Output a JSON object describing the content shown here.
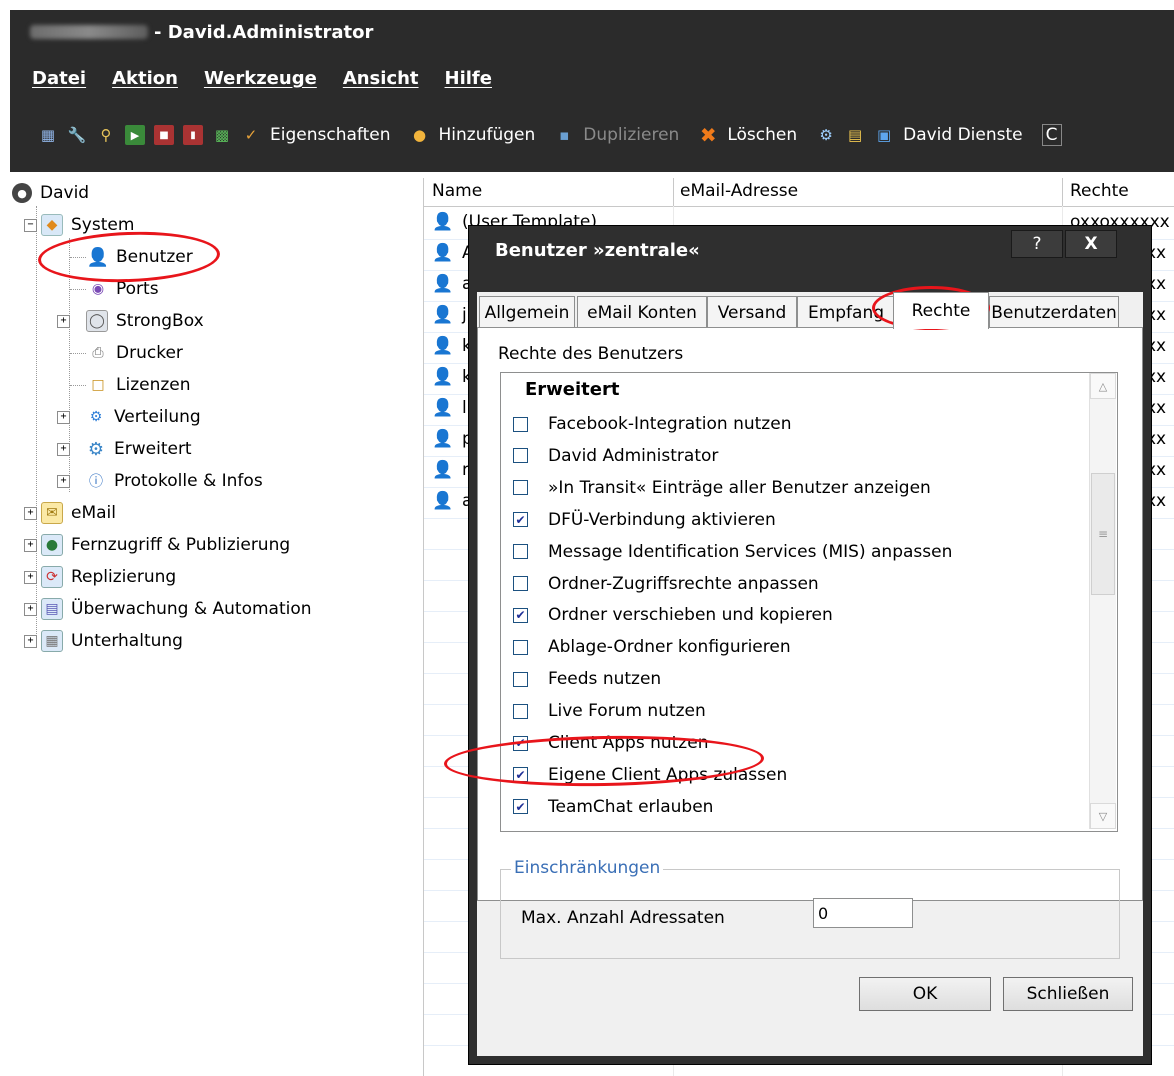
{
  "window": {
    "title": "- David.Administrator"
  },
  "menu": {
    "items": [
      "Datei",
      "Aktion",
      "Werkzeuge",
      "Ansicht",
      "Hilfe"
    ]
  },
  "toolbar": {
    "eigenschaften": "Eigenschaften",
    "hinzufuegen": "Hinzufügen",
    "duplizieren": "Duplizieren",
    "loeschen": "Löschen",
    "david_dienste": "David Dienste",
    "overflow": "C"
  },
  "tree": {
    "root": "David",
    "system": "System",
    "benutzer": "Benutzer",
    "ports": "Ports",
    "strongbox": "StrongBox",
    "drucker": "Drucker",
    "lizenzen": "Lizenzen",
    "verteilung": "Verteilung",
    "erweitert": "Erweitert",
    "protokolle": "Protokolle & Infos",
    "email": "eMail",
    "fernzugriff": "Fernzugriff & Publizierung",
    "replizierung": "Replizierung",
    "ueberwachung": "Überwachung & Automation",
    "unterhaltung": "Unterhaltung"
  },
  "list": {
    "columns": [
      "Name",
      "eMail-Adresse",
      "Rechte"
    ],
    "rows": [
      {
        "initial": "(User Template)",
        "rights": "oxxoxxxxxx"
      },
      {
        "initial": "A",
        "rights": "xx"
      },
      {
        "initial": "a",
        "rights": "xx"
      },
      {
        "initial": "j",
        "rights": "xx"
      },
      {
        "initial": "k",
        "rights": "xx"
      },
      {
        "initial": "k",
        "rights": "xx"
      },
      {
        "initial": "l",
        "rights": "xx"
      },
      {
        "initial": "p",
        "rights": "xx"
      },
      {
        "initial": "r",
        "rights": "xx"
      },
      {
        "initial": "a",
        "rights": "xx"
      }
    ]
  },
  "dialog": {
    "title": "Benutzer »zentrale«",
    "help": "?",
    "close": "X",
    "tabs": [
      "Allgemein",
      "eMail Konten",
      "Versand",
      "Empfang",
      "Rechte",
      "Benutzerdaten"
    ],
    "rights_label": "Rechte des Benutzers",
    "section_header": "Erweitert",
    "rights": [
      {
        "label": "Facebook-Integration nutzen",
        "checked": false
      },
      {
        "label": "David Administrator",
        "checked": false
      },
      {
        "label": "»In Transit« Einträge aller Benutzer anzeigen",
        "checked": false
      },
      {
        "label": "DFÜ-Verbindung aktivieren",
        "checked": true
      },
      {
        "label": "Message Identification Services (MIS) anpassen",
        "checked": false
      },
      {
        "label": "Ordner-Zugriffsrechte anpassen",
        "checked": false
      },
      {
        "label": "Ordner verschieben und kopieren",
        "checked": true
      },
      {
        "label": "Ablage-Ordner konfigurieren",
        "checked": false
      },
      {
        "label": "Feeds nutzen",
        "checked": false
      },
      {
        "label": "Live Forum nutzen",
        "checked": false
      },
      {
        "label": "Client Apps nutzen",
        "checked": true
      },
      {
        "label": "Eigene Client Apps zulassen",
        "checked": true
      },
      {
        "label": "TeamChat erlauben",
        "checked": true
      }
    ],
    "restrictions_legend": "Einschränkungen",
    "max_recipients_label": "Max. Anzahl Adressaten",
    "max_recipients_value": "0",
    "ok": "OK",
    "schliessen": "Schließen"
  },
  "colors": {
    "highlight_ring": "#e8151b",
    "dialog_frame": "#2f2f2f",
    "app_bar": "#2b2b2b",
    "checkmark": "#1e2f97",
    "legend_text": "#3a6fb6"
  }
}
